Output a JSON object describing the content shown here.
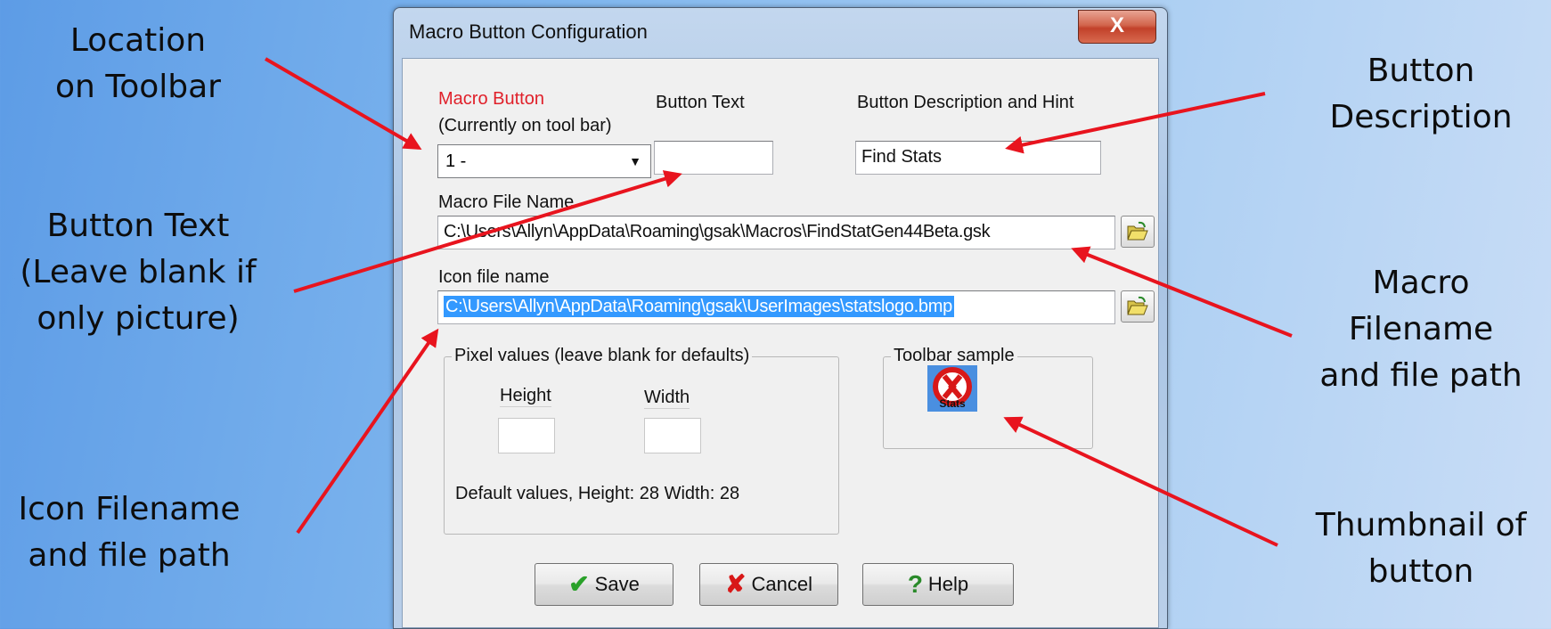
{
  "callouts": {
    "location": [
      "Location",
      "on Toolbar"
    ],
    "button_text": [
      "Button Text",
      "(Leave blank if",
      "only picture)"
    ],
    "icon_filename": [
      "Icon Filename",
      "and file path"
    ],
    "button_description": [
      "Button",
      "Description"
    ],
    "macro_filename": [
      "Macro",
      "Filename",
      "and file path"
    ],
    "thumbnail": [
      "Thumbnail of",
      "button"
    ]
  },
  "dialog": {
    "title": "Macro Button Configuration",
    "close_glyph": "X",
    "macro_button_label": "Macro Button",
    "currently_label": "(Currently on tool bar)",
    "macro_button_value": "1 -",
    "button_text_label": "Button Text",
    "button_text_value": "",
    "description_label": "Button Description and Hint",
    "description_value": "Find Stats",
    "macro_file_label": "Macro File Name",
    "macro_file_value": "C:\\Users\\Allyn\\AppData\\Roaming\\gsak\\Macros\\FindStatGen44Beta.gsk",
    "icon_file_label": "Icon file name",
    "icon_file_value": "C:\\Users\\Allyn\\AppData\\Roaming\\gsak\\UserImages\\statslogo.bmp",
    "pixel_group_title": "Pixel values (leave blank for defaults)",
    "height_label": "Height",
    "width_label": "Width",
    "height_value": "",
    "width_value": "",
    "default_values_text": "Default values, Height: 28 Width: 28",
    "toolbar_sample_title": "Toolbar sample",
    "sample_icon_text": "Stats",
    "save_label": "Save",
    "cancel_label": "Cancel",
    "help_label": "Help",
    "save_icon": "check-icon",
    "cancel_icon": "x-icon",
    "help_icon": "question-icon"
  },
  "colors": {
    "arrow": "#e8141e",
    "label_red": "#e0202a",
    "selection": "#3399ff"
  }
}
